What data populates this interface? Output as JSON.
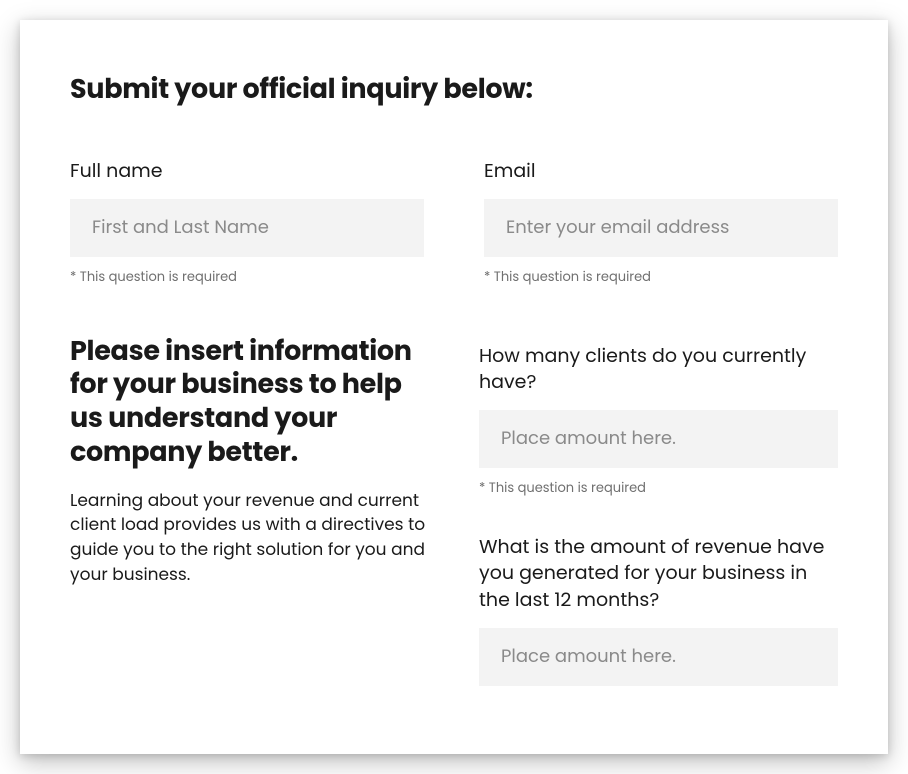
{
  "form": {
    "title": "Submit your official inquiry below:",
    "fullName": {
      "label": "Full name",
      "placeholder": "First and Last Name",
      "required": "* This question is required"
    },
    "email": {
      "label": "Email",
      "placeholder": "Enter your email address",
      "required": "* This question is required"
    },
    "info": {
      "heading": "Please insert information for your business to help us understand your company better.",
      "paragraph": "Learning about your revenue and current client load provides us with a directives to guide you to the right solution for you and your business."
    },
    "clients": {
      "label": "How many clients do you currently have?",
      "placeholder": "Place amount here.",
      "required": "* This question is required"
    },
    "revenue": {
      "label": "What is the amount of revenue have you generated for your business in the last 12 months?",
      "placeholder": "Place amount here."
    }
  }
}
